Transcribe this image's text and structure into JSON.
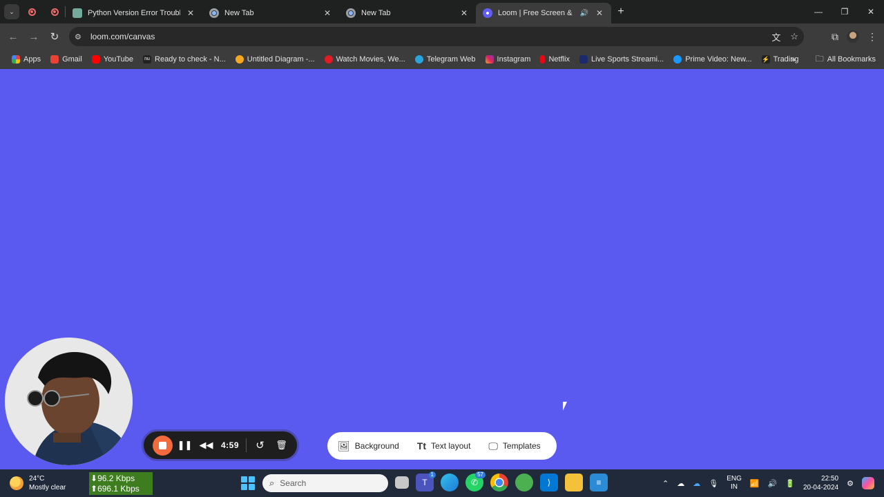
{
  "browser": {
    "tabs": [
      {
        "title": "Python Version Error Troublesh",
        "icon": "chatgpt-icon",
        "active": false
      },
      {
        "title": "New Tab",
        "icon": "chrome-icon",
        "active": false
      },
      {
        "title": "New Tab",
        "icon": "chrome-icon",
        "active": false
      },
      {
        "title": "Loom | Free Screen & Video",
        "icon": "loom-icon",
        "active": true
      }
    ],
    "url": "loom.com/canvas",
    "bookmarks": [
      {
        "label": "Apps"
      },
      {
        "label": "Gmail"
      },
      {
        "label": "YouTube"
      },
      {
        "label": "Ready to check - N..."
      },
      {
        "label": "Untitled Diagram -..."
      },
      {
        "label": "Watch Movies, We..."
      },
      {
        "label": "Telegram Web"
      },
      {
        "label": "Instagram"
      },
      {
        "label": "Netflix"
      },
      {
        "label": "Live Sports Streami..."
      },
      {
        "label": "Prime Video: New..."
      },
      {
        "label": "Trading"
      }
    ],
    "all_bookmarks": "All Bookmarks"
  },
  "loom": {
    "timer": "4:59",
    "options": {
      "background": "Background",
      "text_layout": "Text layout",
      "templates": "Templates"
    },
    "canvas_color": "#5b5af0"
  },
  "taskbar": {
    "weather_temp": "24°C",
    "weather_desc": "Mostly clear",
    "net_down": "96.2 Kbps",
    "net_up": "696.1 Kbps",
    "search_placeholder": "Search",
    "badges": {
      "teams": "1",
      "whatsapp": "57"
    },
    "lang_top": "ENG",
    "lang_bottom": "IN",
    "time": "22:50",
    "date": "20-04-2024"
  }
}
